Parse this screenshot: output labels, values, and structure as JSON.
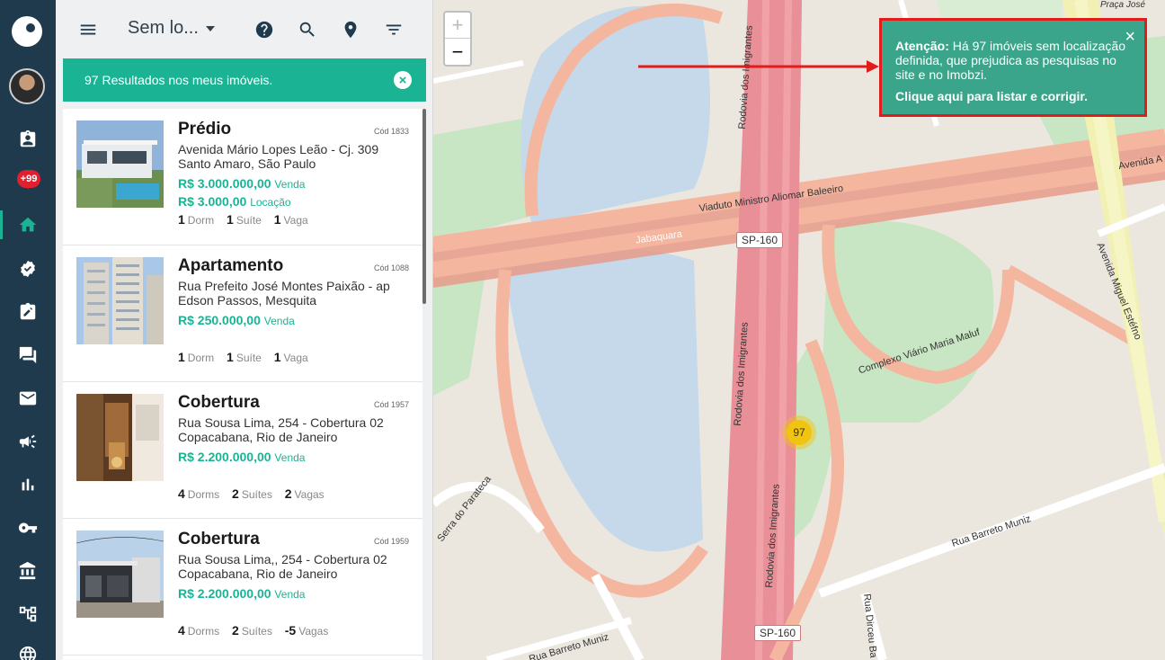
{
  "toolbar": {
    "title": "Sem lo..."
  },
  "results": {
    "text": "97 Resultados nos meus imóveis."
  },
  "notifications": {
    "badge": "+99"
  },
  "listings": [
    {
      "type": "Prédio",
      "code": "Cód 1833",
      "address_line1": "Avenida Mário Lopes Leão - Cj. 309",
      "address_line2": "Santo Amaro, São Paulo",
      "prices": [
        {
          "value": "R$ 3.000.000,00",
          "kind": "Venda"
        },
        {
          "value": "R$ 3.000,00",
          "kind": "Locação"
        }
      ],
      "features": [
        {
          "count": "1",
          "label": "Dorm"
        },
        {
          "count": "1",
          "label": "Suíte"
        },
        {
          "count": "1",
          "label": "Vaga"
        }
      ]
    },
    {
      "type": "Apartamento",
      "code": "Cód 1088",
      "address_line1": "Rua Prefeito José Montes Paixão - ap",
      "address_line2": "Edson Passos, Mesquita",
      "prices": [
        {
          "value": "R$ 250.000,00",
          "kind": "Venda"
        }
      ],
      "features": [
        {
          "count": "1",
          "label": "Dorm"
        },
        {
          "count": "1",
          "label": "Suíte"
        },
        {
          "count": "1",
          "label": "Vaga"
        }
      ]
    },
    {
      "type": "Cobertura",
      "code": "Cód 1957",
      "address_line1": "Rua Sousa Lima, 254 - Cobertura 02",
      "address_line2": "Copacabana, Rio de Janeiro",
      "prices": [
        {
          "value": "R$ 2.200.000,00",
          "kind": "Venda"
        }
      ],
      "features": [
        {
          "count": "4",
          "label": "Dorms"
        },
        {
          "count": "2",
          "label": "Suítes"
        },
        {
          "count": "2",
          "label": "Vagas"
        }
      ]
    },
    {
      "type": "Cobertura",
      "code": "Cód 1959",
      "address_line1": "Rua Sousa Lima,, 254 - Cobertura 02",
      "address_line2": "Copacabana, Rio de Janeiro",
      "prices": [
        {
          "value": "R$ 2.200.000,00",
          "kind": "Venda"
        }
      ],
      "features": [
        {
          "count": "4",
          "label": "Dorms"
        },
        {
          "count": "2",
          "label": "Suítes"
        },
        {
          "count": "-5",
          "label": "Vagas"
        }
      ]
    }
  ],
  "map": {
    "zoom_in": "+",
    "zoom_out": "−",
    "cluster_count": "97",
    "labels": {
      "viaduto": "Viaduto Ministro Aliomar Baleeiro",
      "sp160": "SP-160",
      "jabaquara": "Jabaquara",
      "imigrantes": "Rodovia dos Imigrantes",
      "complexo": "Complexo Viário Maria Maluf",
      "miguel": "Avenida Miguel Estéfno",
      "barreto": "Rua Barreto Muniz",
      "parateca": "Serra do Parateca",
      "dircéu": "Rua Dirceu Ba",
      "praca": "Praça José",
      "avenida": "Avenida A"
    }
  },
  "alert": {
    "title": "Atenção:",
    "message": "Há 97 imóveis sem localização definida, que prejudica as pesquisas no site e no Imobzi.",
    "link": "Clique aqui para listar e corrigir.",
    "close": "×"
  },
  "colors": {
    "accent": "#1ab394",
    "rail": "#1f3a4d",
    "alert_border": "#e21b1b",
    "cluster": "#f1c40f"
  }
}
